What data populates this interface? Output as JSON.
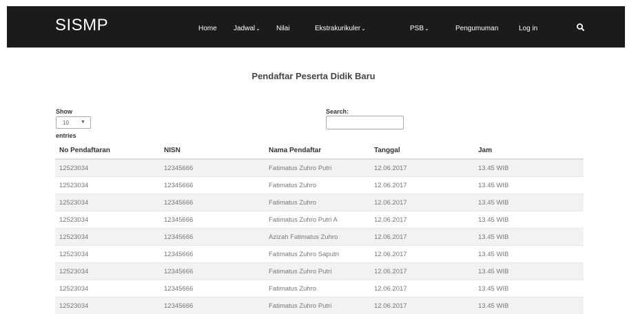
{
  "navbar": {
    "brand": "SISMP",
    "items": [
      {
        "label": "Home",
        "dropdown": false
      },
      {
        "label": "Jadwal",
        "dropdown": true
      },
      {
        "label": "Nilai",
        "dropdown": false
      },
      {
        "label": "Ekstrakurikuler",
        "dropdown": true
      },
      {
        "label": "PSB",
        "dropdown": true
      },
      {
        "label": "Pengumuman",
        "dropdown": false
      },
      {
        "label": "Log in",
        "dropdown": false
      }
    ],
    "search_icon": "search-icon"
  },
  "page": {
    "title": "Pendaftar Peserta Didik Baru"
  },
  "controls": {
    "show_label": "Show",
    "length_value": "10",
    "entries_label": "entries",
    "search_label": "Search:",
    "search_value": ""
  },
  "table": {
    "columns": [
      "No Pendaftaran",
      "NISN",
      "Nama Pendaftar",
      "Tanggal",
      "Jam"
    ],
    "rows": [
      [
        "12523034",
        "12345666",
        "Fatimatus Zuhro Putri",
        "12.06.2017",
        "13.45 WIB"
      ],
      [
        "12523034",
        "12345666",
        "Fatimatus Zuhro",
        "12.06.2017",
        "13.45 WIB"
      ],
      [
        "12523034",
        "12345666",
        "Fatimatus Zuhro",
        "12.06.2017",
        "13.45 WIB"
      ],
      [
        "12523034",
        "12345666",
        "Fatimatus Zuhro Putri A",
        "12.06.2017",
        "13.45 WIB"
      ],
      [
        "12523034",
        "12345666",
        "Azizah Fatimatus Zuhro",
        "12.06.2017",
        "13.45 WIB"
      ],
      [
        "12523034",
        "12345666",
        "Fatimatus Zuhro Saputri",
        "12.06.2017",
        "13.45 WIB"
      ],
      [
        "12523034",
        "12345666",
        "Fatimatus Zuhro Putri",
        "12.06.2017",
        "13.45 WIB"
      ],
      [
        "12523034",
        "12345666",
        "Fatimatus Zuhro",
        "12.06.2017",
        "13.45 WIB"
      ],
      [
        "12523034",
        "12345666",
        "Fatimatus Zuhro Putri",
        "12.06.2017",
        "13.45 WIB"
      ]
    ]
  }
}
